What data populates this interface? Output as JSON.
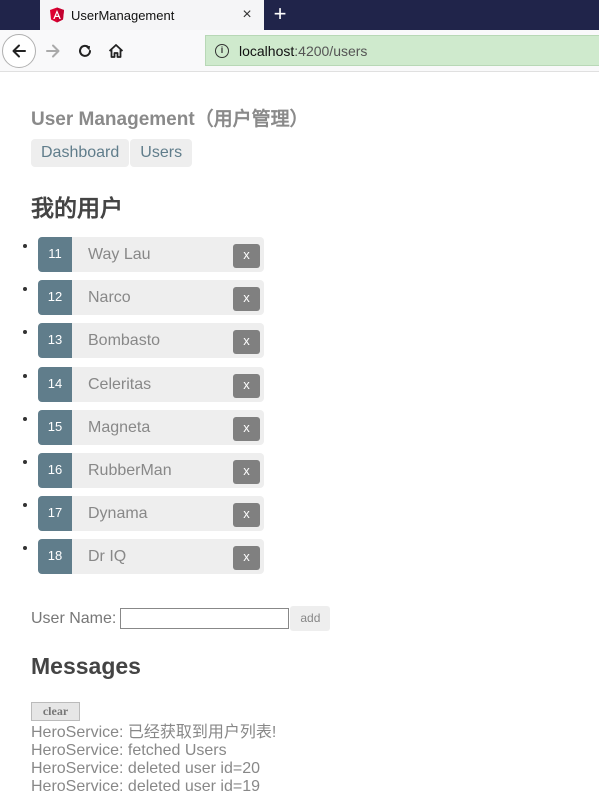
{
  "browser": {
    "tab_title": "UserManagement",
    "tab_close": "×",
    "new_tab": "+",
    "url_host": "localhost",
    "url_path": ":4200/users"
  },
  "app": {
    "title": "User Management（用户管理）",
    "nav": [
      {
        "label": "Dashboard"
      },
      {
        "label": "Users"
      }
    ]
  },
  "heroes_section": {
    "title": "我的用户",
    "delete_label": "x",
    "items": [
      {
        "id": "11",
        "name": "Way Lau"
      },
      {
        "id": "12",
        "name": "Narco"
      },
      {
        "id": "13",
        "name": "Bombasto"
      },
      {
        "id": "14",
        "name": "Celeritas"
      },
      {
        "id": "15",
        "name": "Magneta"
      },
      {
        "id": "16",
        "name": "RubberMan"
      },
      {
        "id": "17",
        "name": "Dynama"
      },
      {
        "id": "18",
        "name": "Dr IQ"
      }
    ]
  },
  "add_form": {
    "label": "User Name:",
    "value": "",
    "button": "add"
  },
  "messages": {
    "title": "Messages",
    "clear_label": "clear",
    "items": [
      "HeroService: 已经获取到用户列表!",
      "HeroService: fetched Users",
      "HeroService: deleted user id=20",
      "HeroService: deleted user id=19"
    ]
  },
  "colors": {
    "tabstrip": "#20244a",
    "urlbar": "#cfeacd",
    "badge": "#607d8b",
    "delete_button": "#808080",
    "angular_red": "#dd0031"
  }
}
